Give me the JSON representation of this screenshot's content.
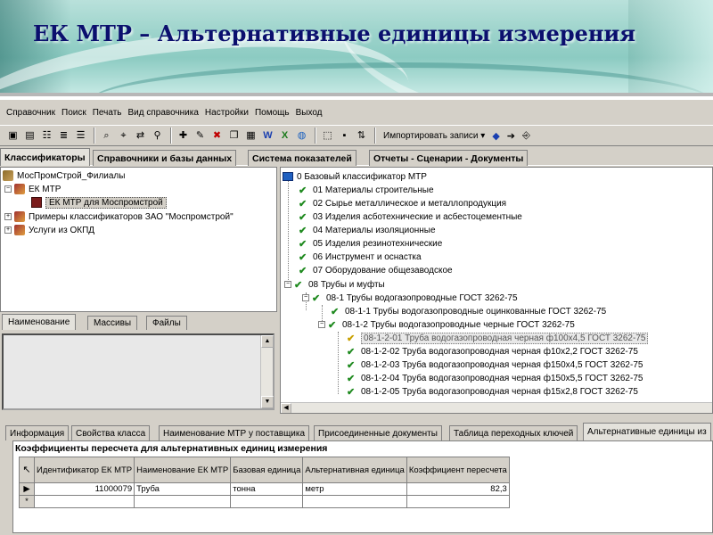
{
  "slide": {
    "title": "ЕК МТР – Альтернативные единицы измерения"
  },
  "menu": [
    "Справочник",
    "Поиск",
    "Печать",
    "Вид справочника",
    "Настройки",
    "Помощь",
    "Выход"
  ],
  "toolbar": {
    "import_label": "Импортировать записи"
  },
  "main_tabs": [
    "Классификаторы",
    "Справочники и базы данных",
    "Система показателей",
    "Отчеты - Сценарии - Документы"
  ],
  "left_tree": {
    "root": "МосПромСтрой_Филиалы",
    "items": [
      {
        "label": "ЕК МТР"
      },
      {
        "label": "ЕК МТР для Моспромстрой"
      },
      {
        "label": "Примеры классификаторов ЗАО \"Моспромстрой\""
      },
      {
        "label": "Услуги из ОКПД"
      }
    ]
  },
  "left_subtabs": [
    "Наименование",
    "Массивы",
    "Файлы"
  ],
  "right_tree": {
    "root": "0 Базовый классификатор МТР",
    "items": [
      "01 Материалы строительные",
      "02 Сырье металлическое и металлопродукция",
      "03 Изделия асботехнические и асбестоцементные",
      "04 Материалы изоляционные",
      "05 Изделия резинотехнические",
      "06 Инструмент и оснастка",
      "07 Оборудование общезаводское",
      "08 Трубы и муфты",
      "08-1 Трубы водогазопроводные ГОСТ 3262-75",
      "08-1-1 Трубы водогазопроводные оцинкованные ГОСТ 3262-75",
      "08-1-2 Трубы водогазопроводные черные ГОСТ 3262-75",
      "08-1-2-01 Труба водогазопроводная черная ф100х4,5 ГОСТ 3262-75",
      "08-1-2-02 Труба водогазопроводная черная ф10х2,2 ГОСТ 3262-75",
      "08-1-2-03 Труба водогазопроводная черная ф150х4,5 ГОСТ 3262-75",
      "08-1-2-04 Труба водогазопроводная черная ф150х5,5 ГОСТ 3262-75",
      "08-1-2-05 Труба водогазопроводная черная ф15х2,8 ГОСТ 3262-75"
    ]
  },
  "bottom_tabs": [
    "Информация",
    "Свойства класса",
    "Наименование МТР у поставщика",
    "Присоединенные документы",
    "Таблица переходных ключей",
    "Альтернативные единицы из"
  ],
  "grid": {
    "title": "Коэффициенты пересчета для альтернативных единиц измерения",
    "columns": [
      "Идентификатор ЕК МТР",
      "Наименование ЕК МТР",
      "Базовая единица",
      "Альтернативная единица",
      "Коэффициент пересчета"
    ],
    "rows": [
      {
        "id": "11000079",
        "name": "Труба",
        "base": "тонна",
        "alt": "метр",
        "coef": "82,3"
      }
    ],
    "new_row_marker": "*",
    "current_row_marker": "▶"
  }
}
